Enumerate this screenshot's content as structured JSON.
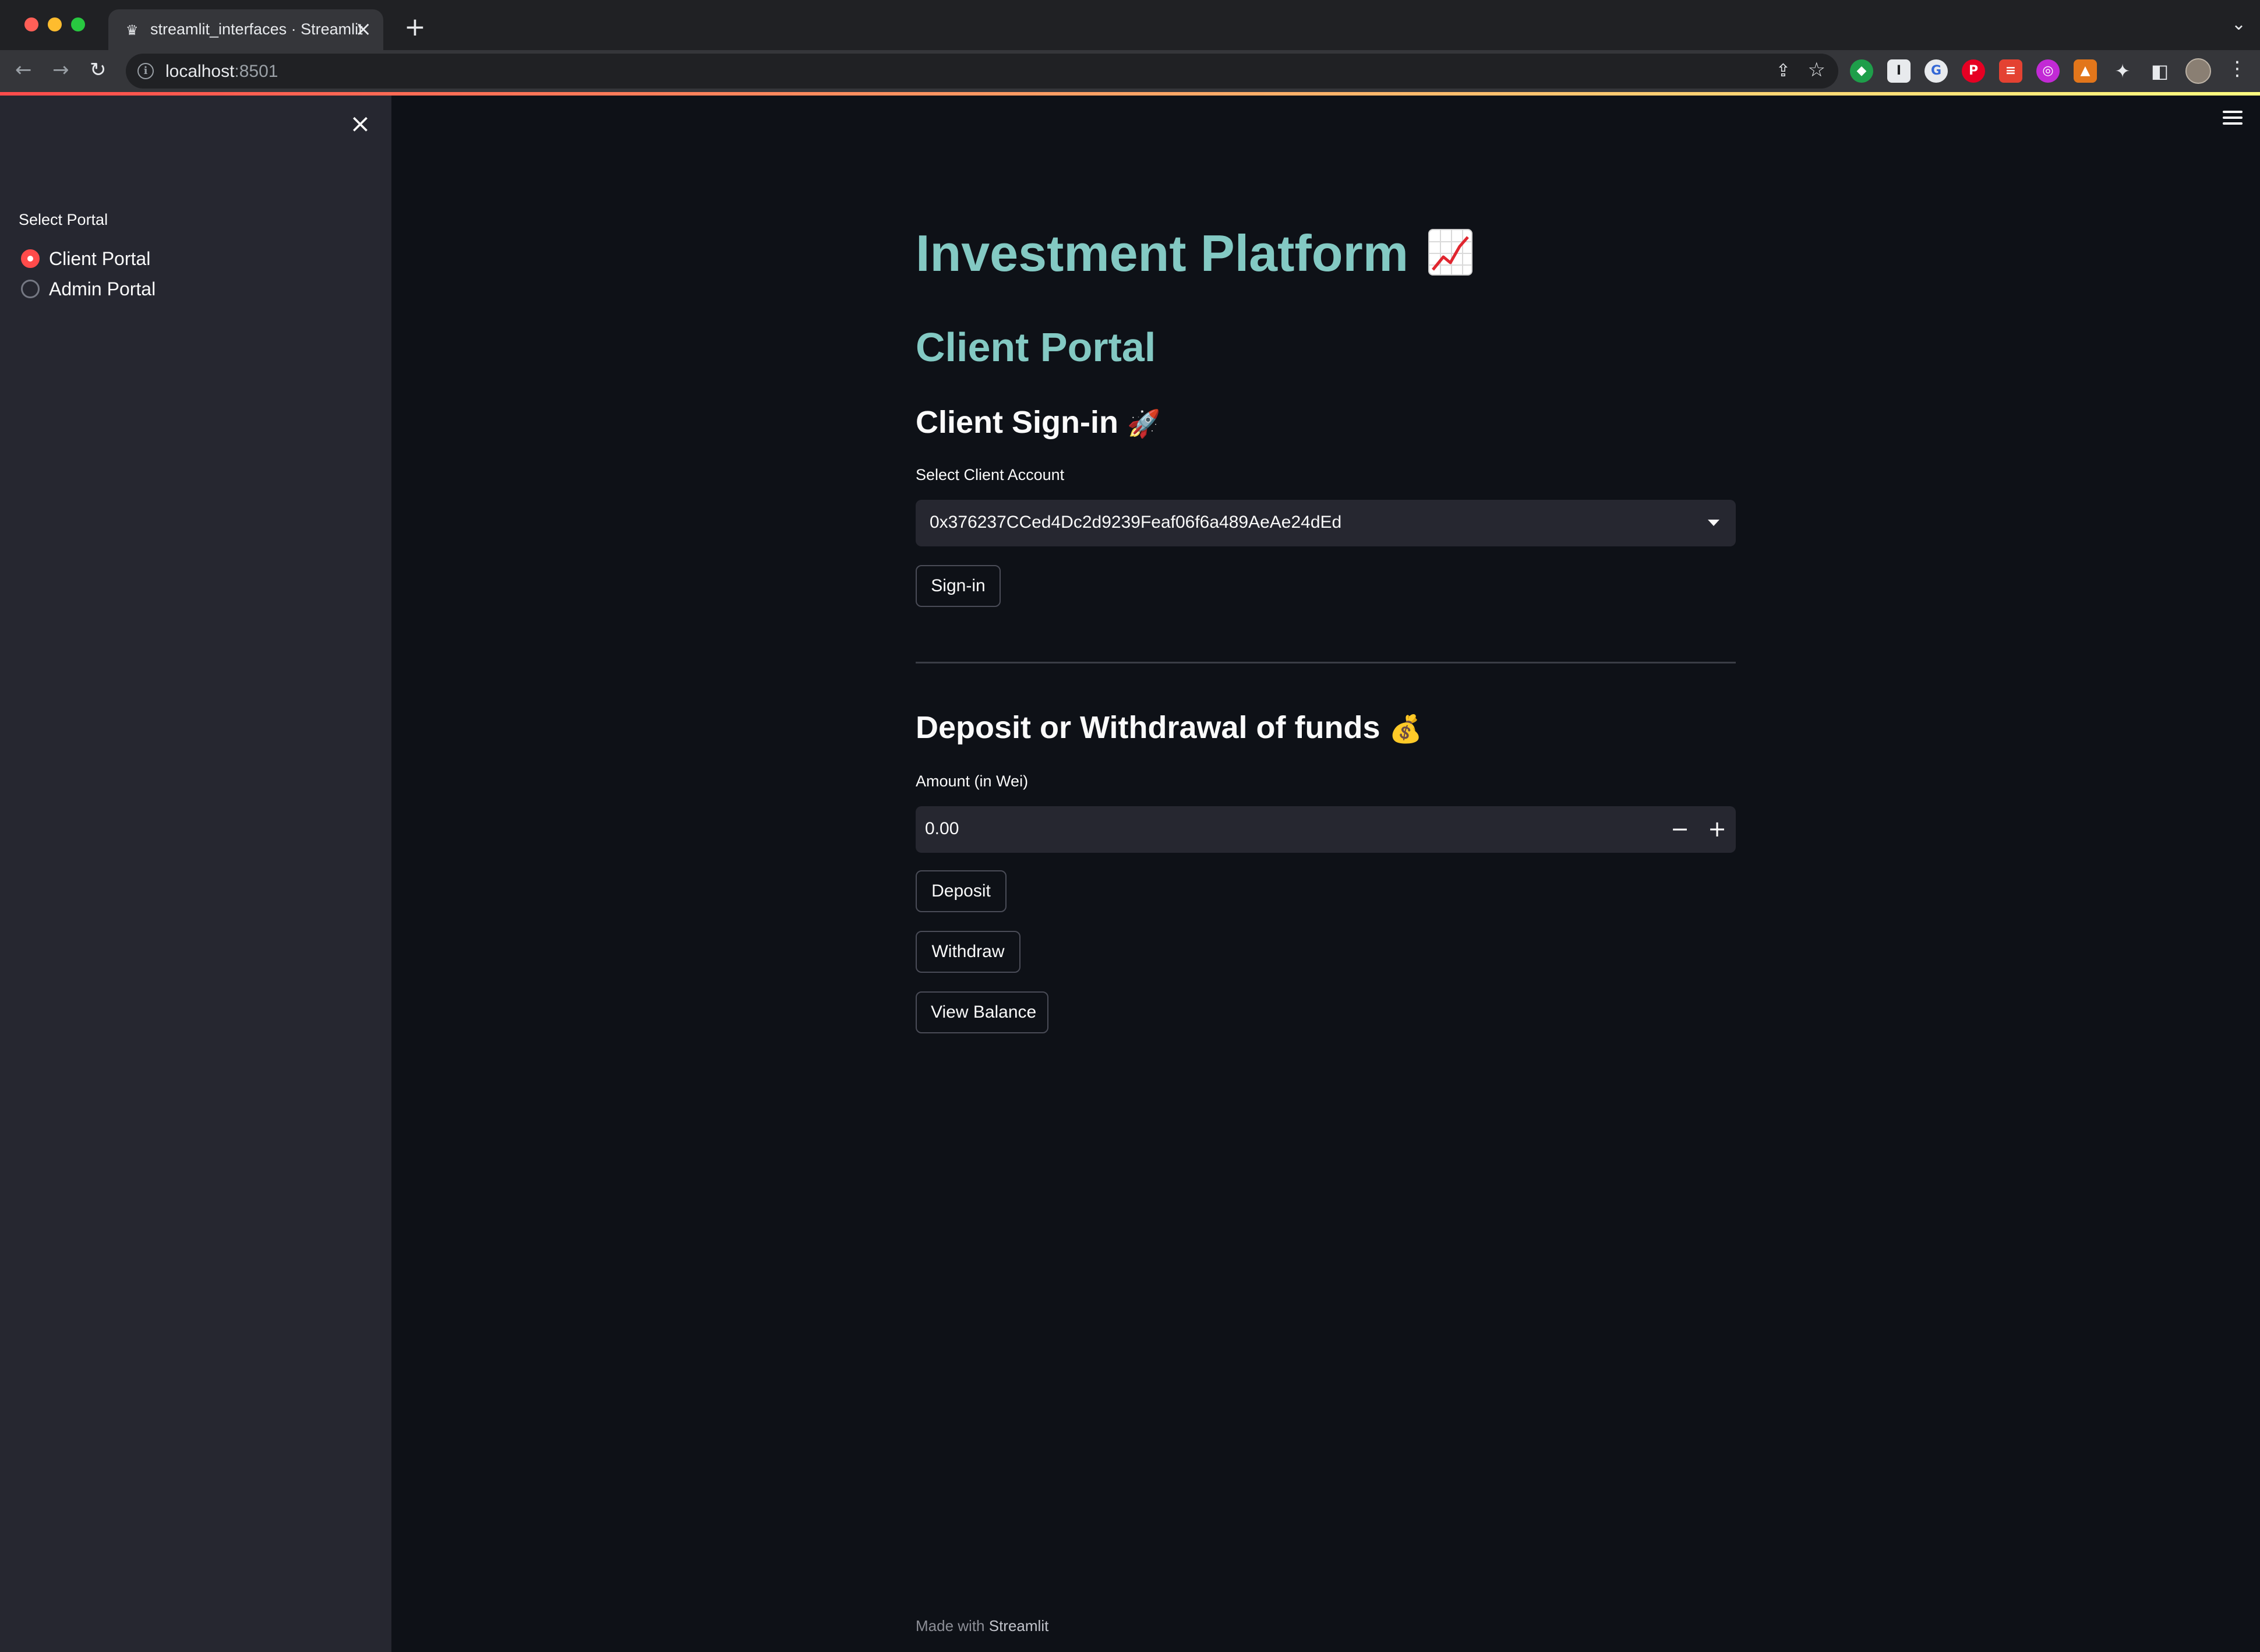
{
  "browser": {
    "tab_title": "streamlit_interfaces · Streamlit",
    "tab_favicon": "streamlit-crown-icon",
    "new_tab_label": "+",
    "url_host": "localhost",
    "url_port": ":8501"
  },
  "sidebar": {
    "radio_label": "Select Portal",
    "options": [
      {
        "label": "Client Portal",
        "selected": true
      },
      {
        "label": "Admin Portal",
        "selected": false
      }
    ]
  },
  "main": {
    "title": "Investment Platform",
    "title_icon": "chart-increasing-icon",
    "portal_heading": "Client Portal",
    "signin": {
      "heading": "Client Sign-in",
      "heading_emoji": "🚀",
      "select_label": "Select Client Account",
      "selected_account": "0x376237CCed4Dc2d9239Feaf06f6a489AeAe24dEd",
      "button": "Sign-in"
    },
    "funds": {
      "heading": "Deposit or Withdrawal of funds",
      "heading_emoji": "💰",
      "amount_label": "Amount (in Wei)",
      "amount_value": "0.00",
      "minus": "−",
      "plus": "+",
      "deposit_button": "Deposit",
      "withdraw_button": "Withdraw",
      "balance_button": "View Balance"
    }
  },
  "footer": {
    "prefix": "Made with",
    "brand": "Streamlit"
  },
  "colors": {
    "accent": "#ff4b4b",
    "heading_teal": "#83c9c3",
    "background": "#0e1117",
    "sidebar_bg": "#262730"
  }
}
